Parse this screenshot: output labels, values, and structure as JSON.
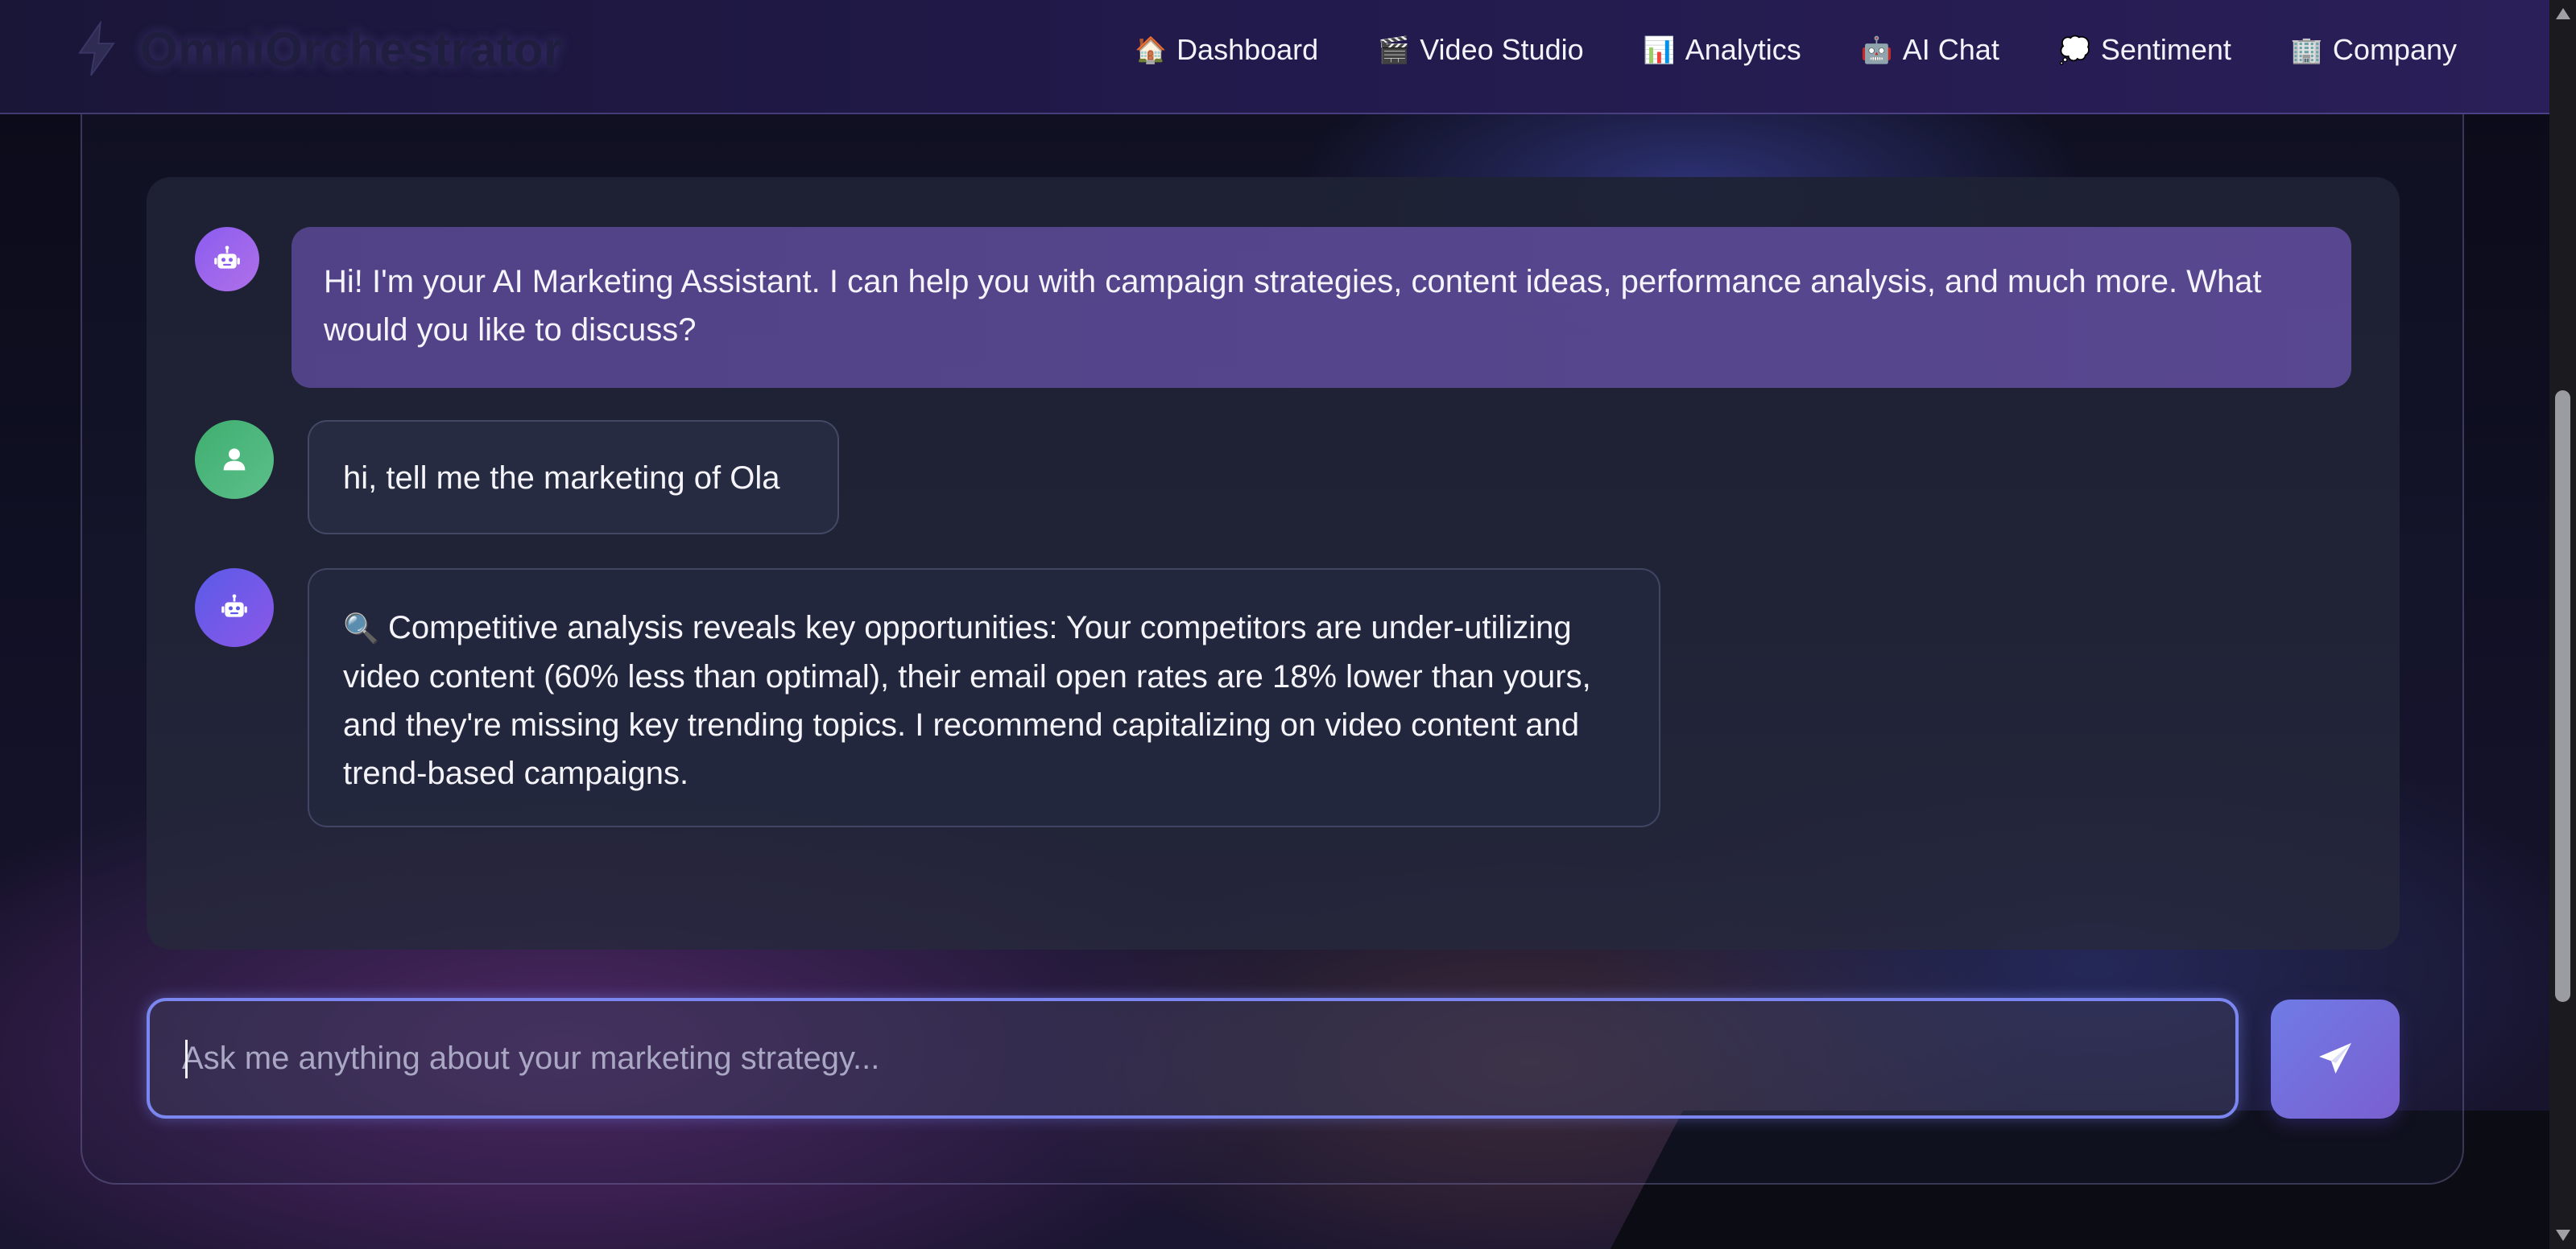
{
  "app": {
    "name": "OmniOrchestrator",
    "logo_icon": "bolt-icon"
  },
  "nav": {
    "items": [
      {
        "label": "Dashboard",
        "emoji": "🏠",
        "icon": "house-icon"
      },
      {
        "label": "Video Studio",
        "emoji": "🎬",
        "icon": "clapper-icon"
      },
      {
        "label": "Analytics",
        "emoji": "📊",
        "icon": "bar-chart-icon"
      },
      {
        "label": "AI Chat",
        "emoji": "🤖",
        "icon": "robot-icon"
      },
      {
        "label": "Sentiment",
        "emoji": "💭",
        "icon": "thought-bubble-icon"
      },
      {
        "label": "Company",
        "emoji": "🏢",
        "icon": "office-building-icon"
      }
    ]
  },
  "chat": {
    "messages": [
      {
        "role": "assistant",
        "avatar_icon": "robot-icon",
        "text": "Hi! I'm your AI Marketing Assistant. I can help you with campaign strategies, content ideas, performance analysis, and much more. What would you like to discuss?"
      },
      {
        "role": "user",
        "avatar_icon": "user-icon",
        "text": "hi, tell me the marketing of Ola"
      },
      {
        "role": "assistant",
        "avatar_icon": "robot-icon",
        "emoji": "🔍",
        "text": "Competitive analysis reveals key opportunities: Your competitors are under-utilizing video content (60% less than optimal), their email open rates are 18% lower than yours, and they're missing key trending topics. I recommend capitalizing on video content and trend-based campaigns."
      }
    ]
  },
  "composer": {
    "value": "",
    "placeholder": "Ask me anything about your marketing strategy...",
    "send_icon": "paper-plane-icon"
  },
  "colors": {
    "accent": "#7b86f0",
    "assistant_bubble": "#5a4896",
    "user_avatar": "#3fae70",
    "bot_avatar": "#8a5cf0"
  }
}
